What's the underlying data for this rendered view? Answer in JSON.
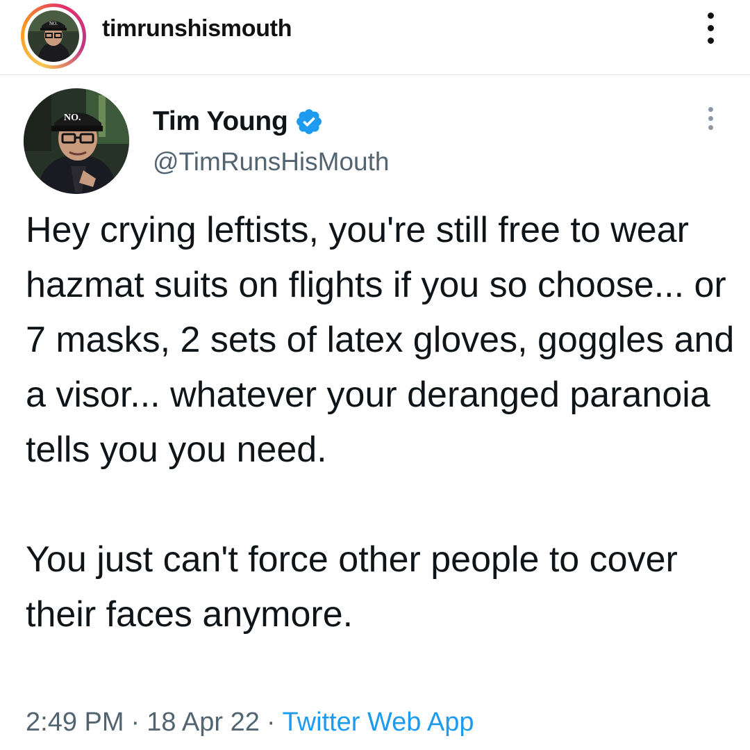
{
  "instagram_header": {
    "username": "timrunshismouth",
    "more_icon": "vertical-ellipsis-icon"
  },
  "tweet": {
    "author": {
      "display_name": "Tim Young",
      "handle": "@TimRunsHisMouth",
      "verified_icon": "verified-badge-icon",
      "hat_text": "NO."
    },
    "more_icon": "vertical-ellipsis-icon",
    "paragraphs": [
      "Hey crying leftists, you're still free to wear hazmat suits on flights if you so choose... or 7 masks, 2 sets of latex gloves, goggles and a visor... whatever your deranged paranoia tells you you need.",
      "You just can't force other people to cover their faces anymore."
    ],
    "time": "2:49 PM",
    "separator": "·",
    "date": "18 Apr 22",
    "source": "Twitter Web App"
  },
  "colors": {
    "text": "#0f1419",
    "secondary_text": "#536471",
    "link_blue": "#1d9bf0",
    "verified_blue": "#1d9bf0"
  }
}
